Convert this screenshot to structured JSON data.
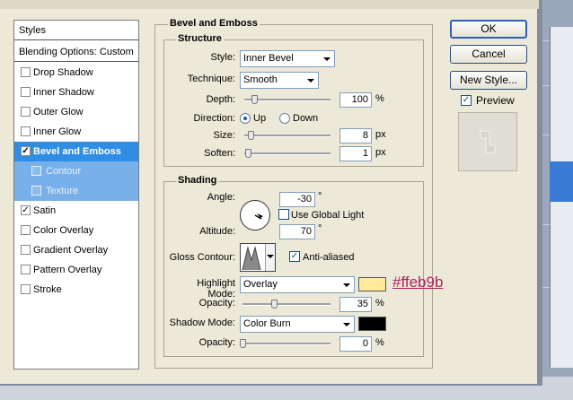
{
  "styles_list": {
    "header": "Styles",
    "blending": "Blending Options: Custom",
    "items": [
      {
        "label": "Drop Shadow",
        "checked": ""
      },
      {
        "label": "Inner Shadow",
        "checked": ""
      },
      {
        "label": "Outer Glow",
        "checked": ""
      },
      {
        "label": "Inner Glow",
        "checked": ""
      },
      {
        "label": "Bevel and Emboss",
        "checked": "✓"
      },
      {
        "label": "Contour",
        "checked": ""
      },
      {
        "label": "Texture",
        "checked": ""
      },
      {
        "label": "Satin",
        "checked": "✓"
      },
      {
        "label": "Color Overlay",
        "checked": ""
      },
      {
        "label": "Gradient Overlay",
        "checked": ""
      },
      {
        "label": "Pattern Overlay",
        "checked": ""
      },
      {
        "label": "Stroke",
        "checked": ""
      }
    ]
  },
  "panel": {
    "title": "Bevel and Emboss",
    "structure": {
      "title": "Structure",
      "style_label": "Style:",
      "style_value": "Inner Bevel",
      "technique_label": "Technique:",
      "technique_value": "Smooth",
      "depth_label": "Depth:",
      "depth_value": "100",
      "depth_unit": "%",
      "depth_level": 0.1,
      "direction_label": "Direction:",
      "direction_up": "Up",
      "direction_down": "Down",
      "size_label": "Size:",
      "size_value": "8",
      "size_unit": "px",
      "soften_label": "Soften:",
      "soften_value": "1",
      "soften_unit": "px"
    },
    "shading": {
      "title": "Shading",
      "angle_label": "Angle:",
      "angle_value": "-30",
      "angle_unit": "°",
      "global_light_label": "Use Global Light",
      "altitude_label": "Altitude:",
      "altitude_value": "70",
      "altitude_unit": "°",
      "gloss_label": "Gloss Contour:",
      "anti_aliased_label": "Anti-aliased",
      "highlight_label": "Highlight Mode:",
      "highlight_value": "Overlay",
      "highlight_color": "#ffeb9b",
      "highlight_annotation": "#ffeb9b",
      "highlight_opacity_label": "Opacity:",
      "highlight_opacity_value": "35",
      "highlight_opacity_unit": "%",
      "shadow_label": "Shadow Mode:",
      "shadow_value": "Color Burn",
      "shadow_color": "#000000",
      "shadow_opacity_label": "Opacity:",
      "shadow_opacity_value": "0",
      "shadow_opacity_unit": "%"
    }
  },
  "buttons": {
    "ok": "OK",
    "cancel": "Cancel",
    "new_style": "New Style...",
    "preview_label": "Preview"
  },
  "colors": {
    "selected_row": "#2f8de4",
    "sub_row": "#78b0ea",
    "annotation": "#b01f5a"
  }
}
